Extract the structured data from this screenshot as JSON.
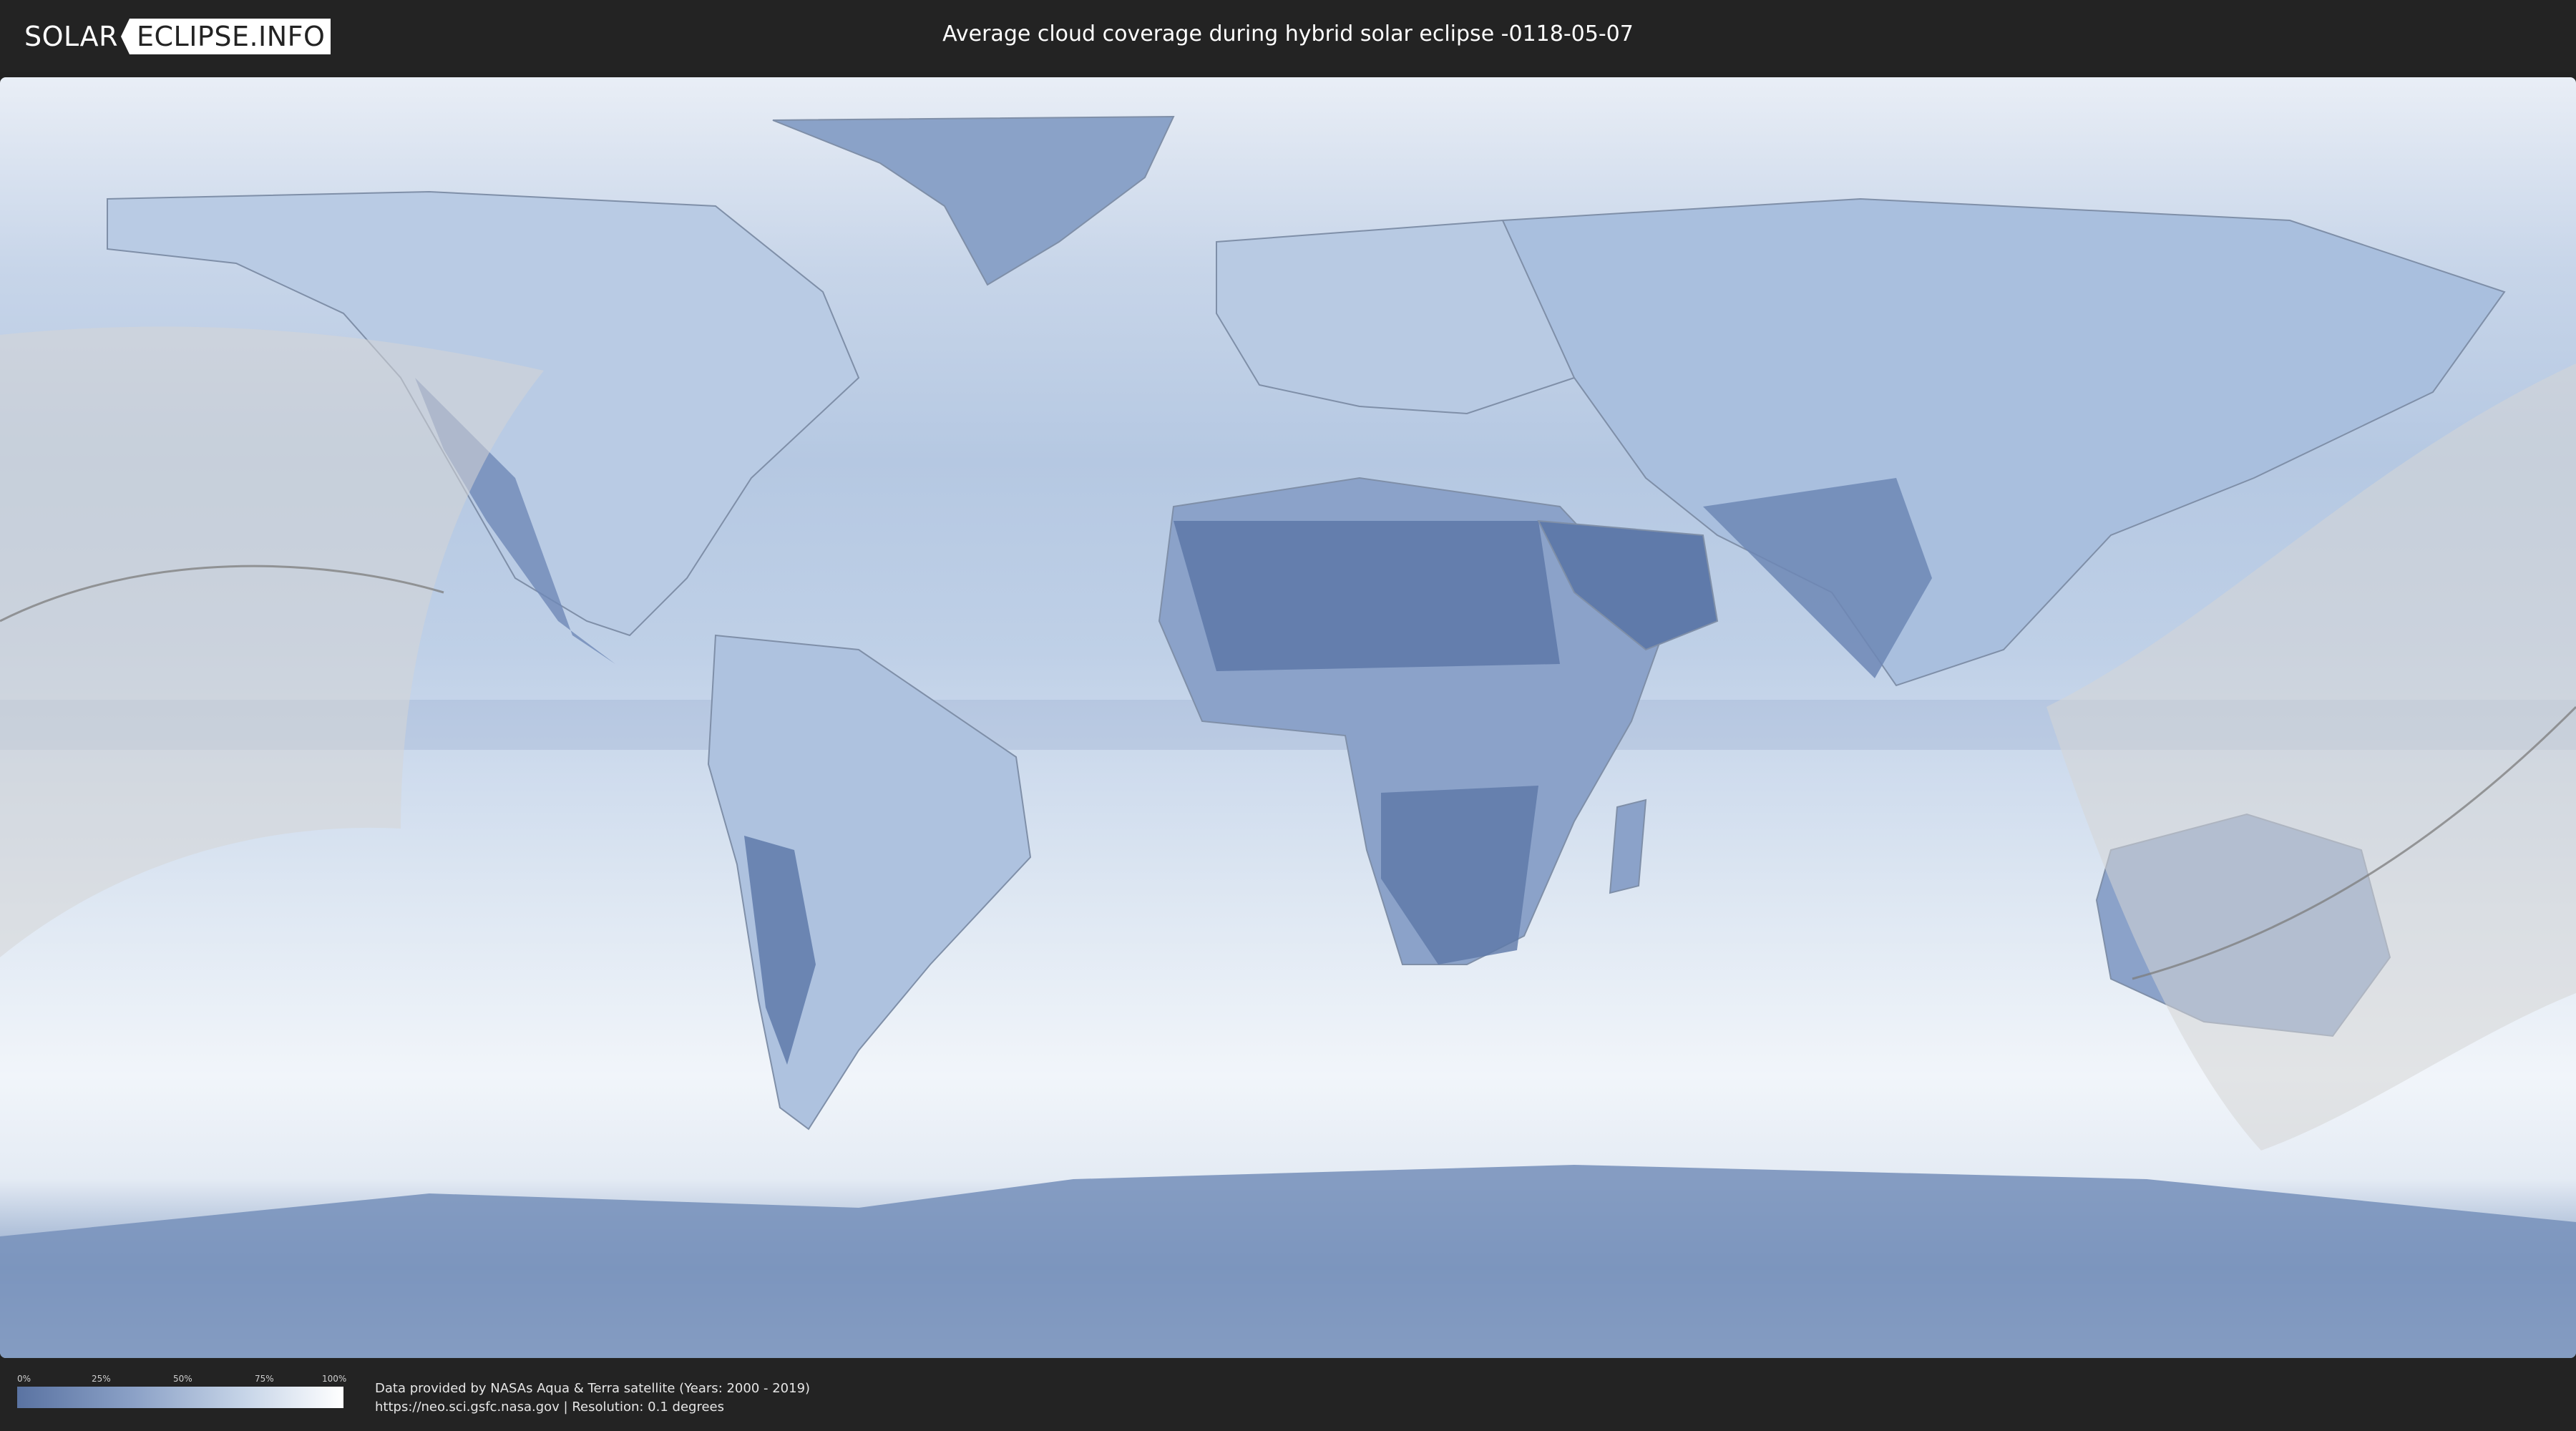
{
  "header": {
    "logo_left": "SOLAR",
    "logo_right": "ECLIPSE.INFO",
    "title": "Average cloud coverage during hybrid solar eclipse -0118-05-07"
  },
  "map": {
    "description_colors": {
      "land_clear": "#5d78a8",
      "cloud_mid": "#9fb6d6",
      "cloud_full": "#f4f7fb",
      "eclipse_overlay": "#d9d9d9"
    }
  },
  "legend": {
    "ticks": [
      "0%",
      "25%",
      "50%",
      "75%",
      "100%"
    ],
    "gradient_from": "#5a73a2",
    "gradient_to": "#ffffff"
  },
  "credits": {
    "line1": "Data provided by NASAs Aqua & Terra satellite (Years: 2000 - 2019)",
    "line2": "https://neo.sci.gsfc.nasa.gov | Resolution: 0.1 degrees"
  }
}
